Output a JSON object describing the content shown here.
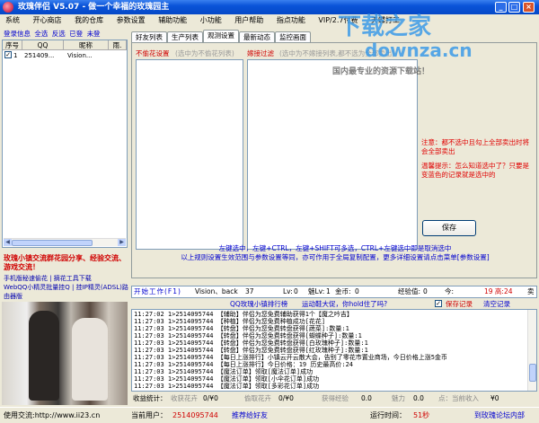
{
  "window": {
    "title": "玫瑰伴侣 V5.07 - 做一个幸福的玫瑰园主",
    "buttons": [
      "_",
      "□",
      "×"
    ]
  },
  "menu": [
    "系统",
    "开心商店",
    "我的仓库",
    "参数设置",
    "辅助功能",
    "小功能",
    "用户帮助",
    "指点功能",
    "VIP/2.7付费",
    "天蝶打工"
  ],
  "left": {
    "links": [
      "登录信息",
      "全选",
      "反选",
      "已登",
      "未登"
    ],
    "table_headers": [
      "序号",
      "QQ",
      "昵称",
      "雨."
    ],
    "rows": [
      {
        "checked": true,
        "no": "1",
        "qq": "251409...",
        "nick": "Vision..."
      }
    ],
    "promo_line1": "玫瑰小镇交流群花园分享、经验交流、游戏交流！",
    "promo_line2": "手机版秘速偷花 | 摘花工具下载",
    "promo_line3": "WebQQ小精灵批量挂Q | 挂IP精灵(ADSL)路由器版",
    "contact_label": "使用交流:http://www.ii23.cn"
  },
  "tabs": [
    "好友列表",
    "生产列表",
    "观测设置",
    "最新动态",
    "监控画面"
  ],
  "settings": {
    "group1_title": "不偷花设置",
    "group1_note": "(选中为不偷花列表)",
    "group2_title": "嫁接过滤",
    "group2_note": "(选中为不嫁接列表,都不选为全部卖出)",
    "note1": "注意：都不选中且勾上全部卖出时将会全部卖出",
    "note2": "温馨提示：怎么知道选中了？只要是变蓝色的记录就是选中的",
    "save_label": "保存",
    "hint1": "左键选中，左键+CTRL，左键+SHIFT可多选，CTRL+左键选中即是取消选中",
    "hint2": "以上规则设置生效范围与参数设置等同，亦可作用于全局复制配置，更多详细设置请点击菜单[参数设置]"
  },
  "stats": {
    "work_label": "开始工作(F1)",
    "user": "Vision、back",
    "level_label": "Lv:",
    "level_value": "0",
    "charm_label": "魅Lv:",
    "charm_value": "1",
    "gold_label": "金币:",
    "gold_value": "0",
    "exp_label": "经验值:",
    "exp_value": "0",
    "time_label": "今:",
    "time_value": "19 高:24",
    "sell_label": "卖",
    "value_37": "37"
  },
  "log": {
    "header": "QQ玫瑰小镇排行榜",
    "sub": "运动鞋大促，你hold住了吗?",
    "save_log_label": "保存记录",
    "clear_log_label": "清空记录",
    "lines": [
      "11:27:02  1>2514095744  【辅助】伴侣为您免费辅助获得1个【魔之吟吉】",
      "11:27:03  1>2514095744  【种植】伴侣为您免费种植成功[花花]",
      "11:27:03  1>2514095744  【转盘】伴侣为您免费转盘获得[蔬菜]:数量:1",
      "11:27:03  1>2514095744  【转盘】伴侣为您免费转盘获得[蝴蝶种子]:数量:1",
      "11:27:03  1>2514095744  【转盘】伴侣为您免费转盘获得[白玫瑰种子]:数量:1",
      "11:27:03  1>2514095744  【转盘】伴侣为您免费转盘获得[红玫瑰种子]:数量:1",
      "11:27:03  1>2514095744  【每日上涨排行】小镇云开云散大会，告别了零花市置业商场，今日价格上涨5金币",
      "11:27:03  1>2514095744  【每日上涨排行】今日价格：19 历史最高价:24",
      "11:27:03  1>2514095744  【魔法订单】领取[魔法订单]成功",
      "11:27:03  1>2514095744  【魔法订单】领取[小伞花订单]成功",
      "11:27:03  1>2514095744  【魔法订单】领取[多彩花订单]成功",
      "11:27:03  1>2514095744  【魔法订单】领取[玫瑰订单]成功"
    ]
  },
  "revenue": {
    "label": "收益统计：",
    "items": [
      "收获花卉",
      "0/¥0",
      "偷取花卉",
      "0/¥0",
      "获得经验",
      "0.0",
      "魅力",
      "0.0",
      "点：当前收入",
      "¥0"
    ]
  },
  "status": {
    "current_user_label": "当前用户：",
    "current_user": "2514095744",
    "recommend": "推荐给好友",
    "run_time_label": "运行时间：",
    "run_time": "51秒",
    "forum": "到玫瑰论坛内部"
  },
  "watermark": {
    "line1": "下载之家",
    "line2": "downza.cn",
    "line3": "国内最专业的资源下载站！"
  },
  "colors": {
    "title_blue": "#0A54D8",
    "accent_red": "#E00000",
    "link_blue": "#0000D0"
  }
}
